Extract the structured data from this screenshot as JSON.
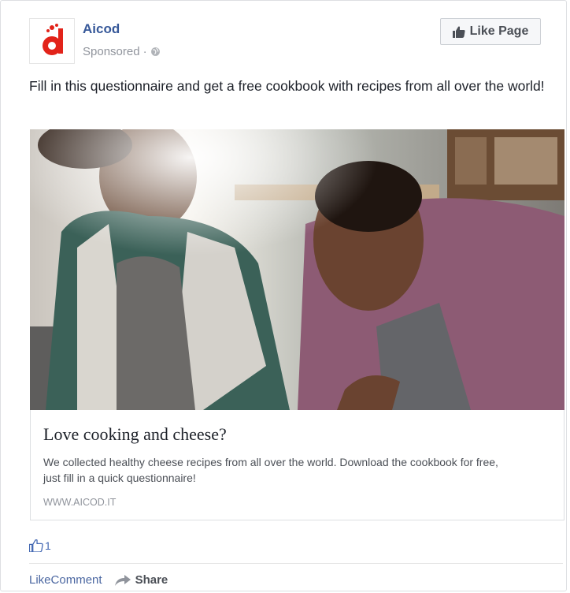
{
  "post": {
    "page_name": "Aicod",
    "sponsored_label": "Sponsored",
    "sponsored_separator": "·",
    "like_page_label": "Like Page",
    "text": "Fill in this questionnaire and get a free cookbook with recipes from all over the world!"
  },
  "link": {
    "title": "Love cooking and cheese?",
    "description": "We collected healthy cheese recipes from all over the world. Download the cookbook for free, just fill in a quick questionnaire!",
    "url": "WWW.AICOD.IT"
  },
  "reactions": {
    "like_count": "1"
  },
  "actions": {
    "like_label": "Like",
    "comment_label": "Comment",
    "share_label": "Share"
  },
  "colors": {
    "brand_red": "#e2231a",
    "link_blue": "#365899"
  },
  "icons": [
    "logo-icon",
    "globe-icon",
    "thumbs-up-icon",
    "like-count-icon",
    "share-arrow-icon"
  ]
}
